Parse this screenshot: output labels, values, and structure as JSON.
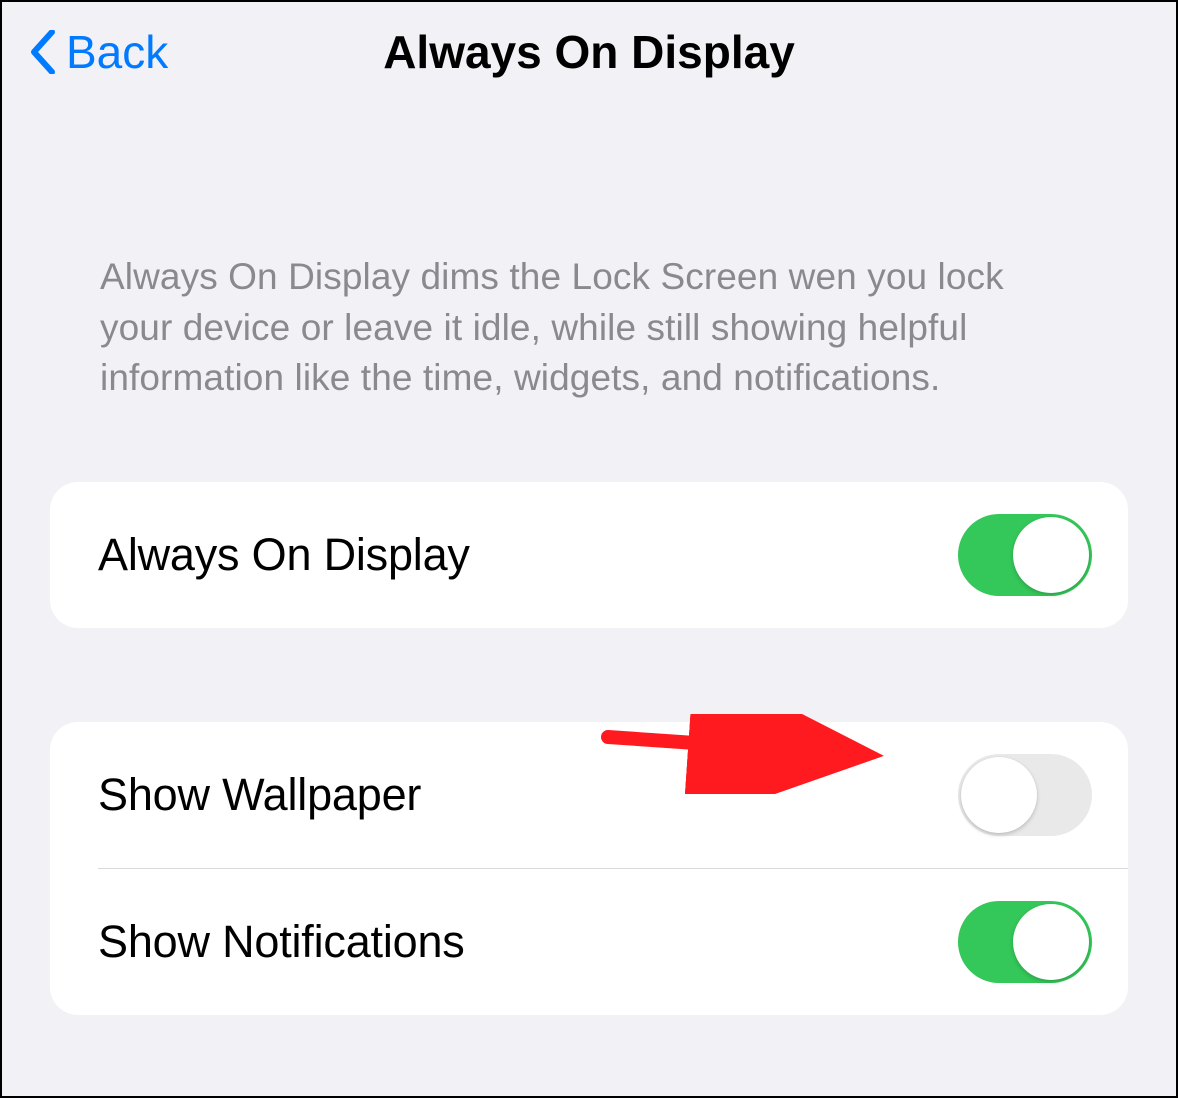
{
  "nav": {
    "back_label": "Back",
    "title": "Always On Display"
  },
  "description": "Always On Display dims the Lock Screen wen you lock your device or leave it idle, while still showing helpful information like the time, widgets, and notifications.",
  "groups": [
    {
      "rows": [
        {
          "label": "Always On Display",
          "on": true
        }
      ]
    },
    {
      "rows": [
        {
          "label": "Show Wallpaper",
          "on": false
        },
        {
          "label": "Show Notifications",
          "on": true
        }
      ]
    }
  ],
  "annotation": {
    "arrow_target": "show-wallpaper-toggle",
    "color": "#ff1a1f"
  }
}
